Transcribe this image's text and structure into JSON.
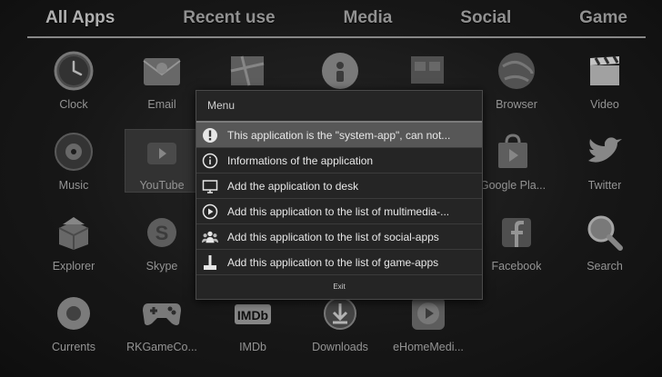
{
  "tabs": [
    "All Apps",
    "Recent use",
    "Media",
    "Social",
    "Game"
  ],
  "apps": {
    "clock": "Clock",
    "email": "Email",
    "browser": "Browser",
    "video": "Video",
    "music": "Music",
    "youtube": "YouTube",
    "google_play": "Google Pla...",
    "twitter": "Twitter",
    "explorer": "Explorer",
    "skype": "Skype",
    "facebook": "Facebook",
    "search": "Search",
    "currents": "Currents",
    "rkgame": "RKGameCo...",
    "imdb": "IMDb",
    "downloads": "Downloads",
    "ehome": "eHomeMedi..."
  },
  "icon_texts": {
    "imdb": "IMDb"
  },
  "menu": {
    "title": "Menu",
    "items": [
      {
        "icon": "alert-icon",
        "label": "This application is the \"system-app\", can not..."
      },
      {
        "icon": "info-icon",
        "label": "Informations of the application"
      },
      {
        "icon": "monitor-icon",
        "label": "Add the application to desk"
      },
      {
        "icon": "play-circle-icon",
        "label": "Add this application to the list of multimedia-..."
      },
      {
        "icon": "people-icon",
        "label": "Add this application to the list of social-apps"
      },
      {
        "icon": "joystick-icon",
        "label": "Add this application to the list of game-apps"
      }
    ],
    "exit": "Exit"
  },
  "colors": {
    "background": "#1b1b1b",
    "menu_bg": "#252525",
    "highlight": "#575757",
    "tab_underline": "#9a9a9a"
  }
}
